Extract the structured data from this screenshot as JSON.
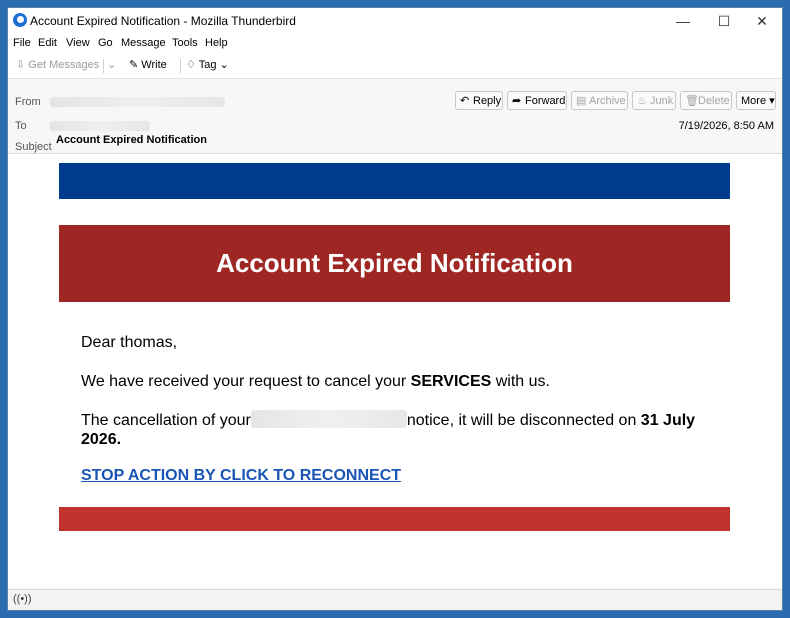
{
  "window": {
    "title": "Account Expired Notification - Mozilla Thunderbird"
  },
  "menu": [
    "File",
    "Edit",
    "View",
    "Go",
    "Message",
    "Tools",
    "Help"
  ],
  "toolbar": {
    "get_messages": "Get Messages",
    "write": "Write",
    "tag": "Tag"
  },
  "header": {
    "from_label": "From",
    "to_label": "To",
    "subject_label": "Subject",
    "subject": "Account Expired Notification",
    "date": "7/19/2026, 8:50 AM",
    "buttons": {
      "reply": "Reply",
      "forward": "Forward",
      "archive": "Archive",
      "junk": "Junk",
      "delete": "Delete",
      "more": "More"
    }
  },
  "email": {
    "banner_title": "Account Expired Notification",
    "greeting": "Dear thomas,",
    "line1_prefix": "We have received your request to cancel your ",
    "line1_bold": "SERVICES",
    "line1_suffix": " with us.",
    "line2_prefix": "The cancellation of your",
    "line2_middle": "notice, it will be disconnected on ",
    "line2_bold": "31 July 2026.",
    "link": "STOP ACTION BY CLICK TO RECONNECT"
  },
  "colors": {
    "banner_blue": "#003b8e",
    "banner_red": "#9f2723",
    "footer_red": "#c0322c",
    "link": "#1a55b5"
  }
}
